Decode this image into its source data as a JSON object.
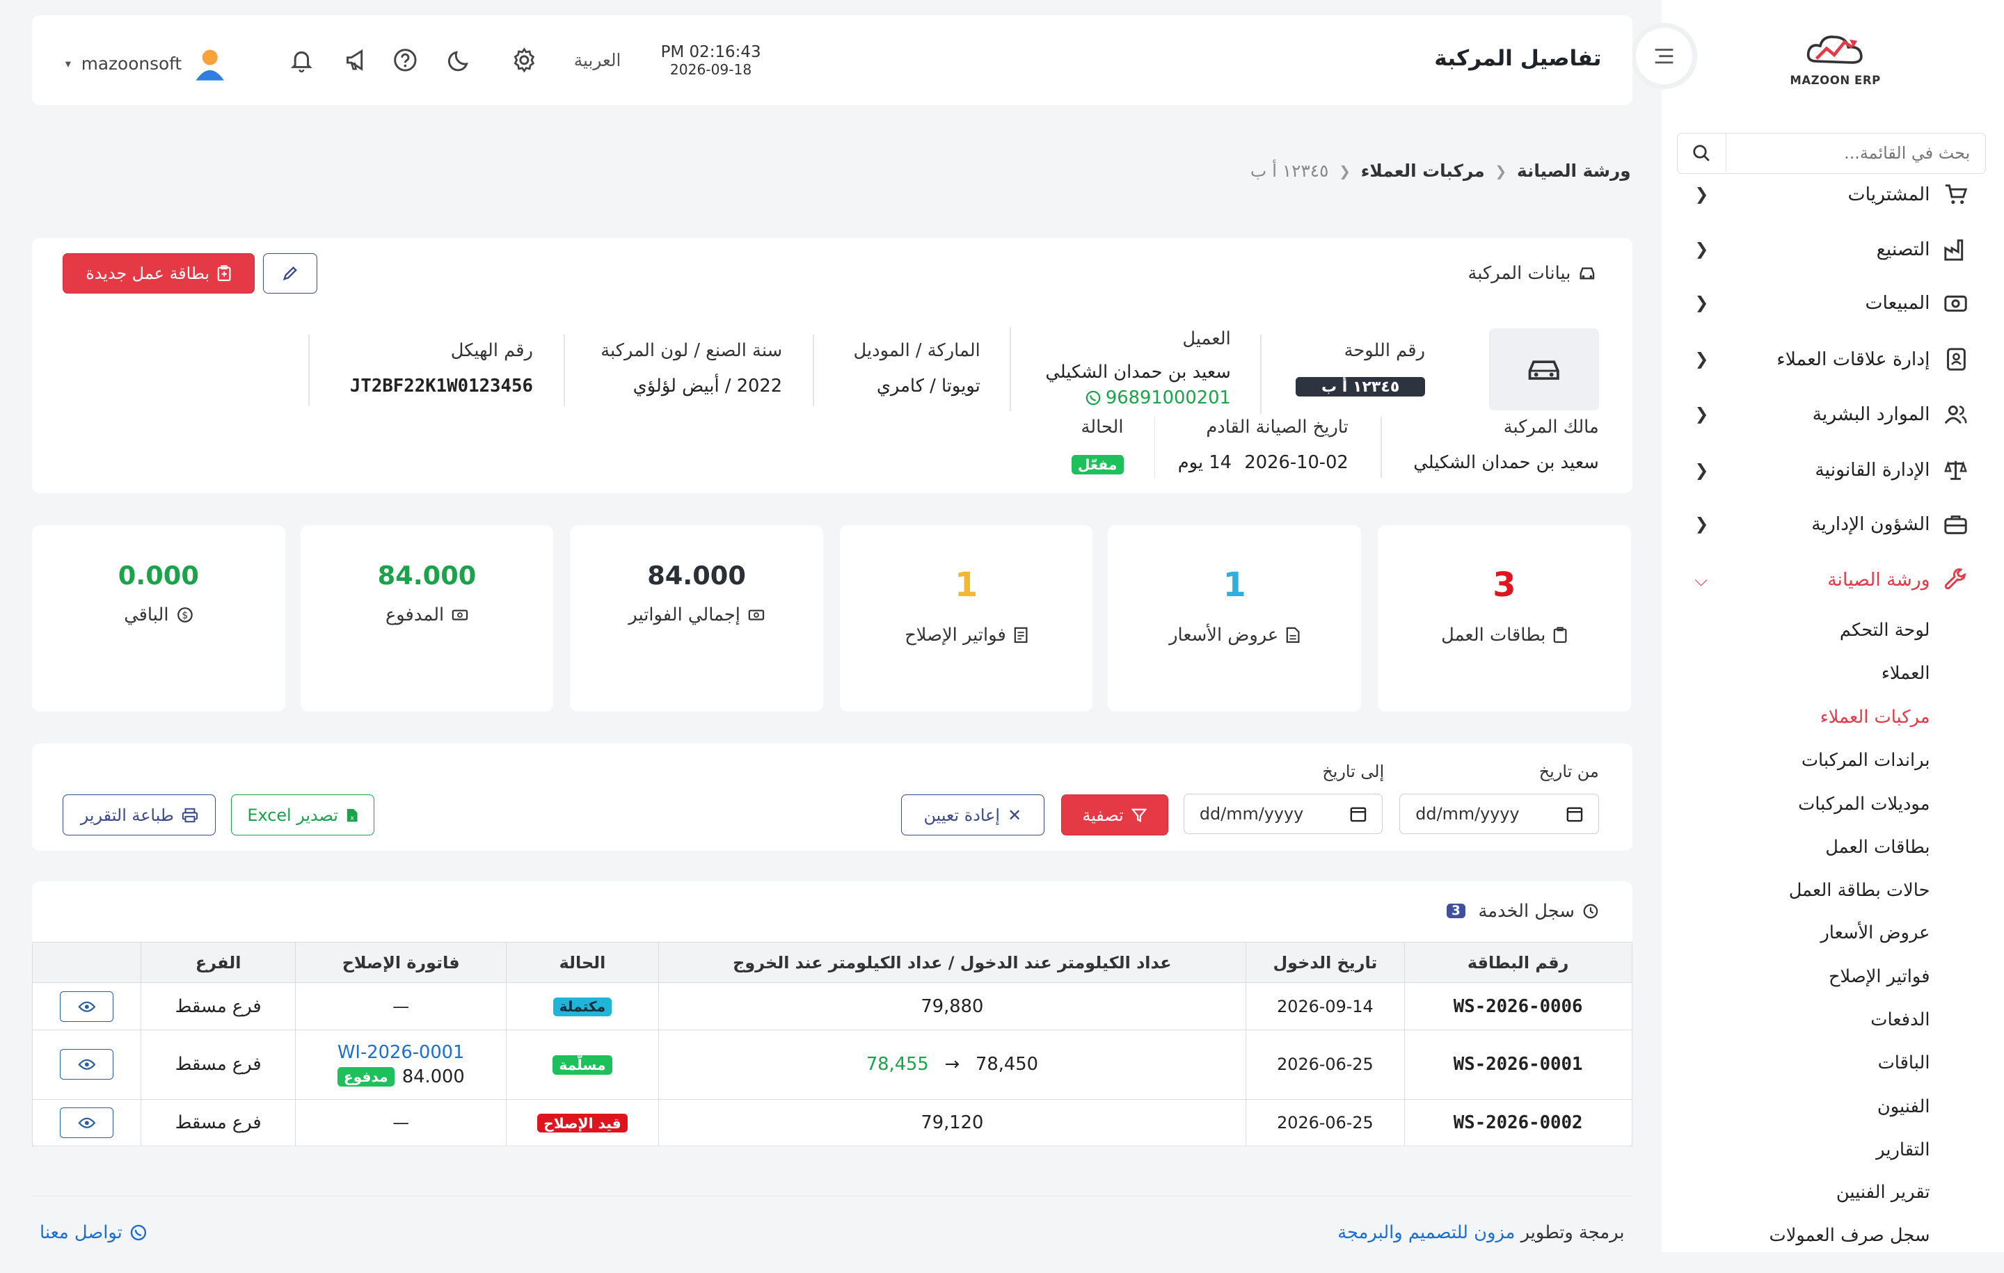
{
  "app": {
    "brand": "MAZOON ERP"
  },
  "sidebar": {
    "search_placeholder": "بحث في القائمة...",
    "items": [
      {
        "label": "المشتريات",
        "icon": "cart-icon"
      },
      {
        "label": "التصنيع",
        "icon": "factory-icon"
      },
      {
        "label": "المبيعات",
        "icon": "cash-icon"
      },
      {
        "label": "إدارة علاقات العملاء",
        "icon": "contacts-icon"
      },
      {
        "label": "الموارد البشرية",
        "icon": "users-icon"
      },
      {
        "label": "الإدارة القانونية",
        "icon": "scale-icon"
      },
      {
        "label": "الشؤون الإدارية",
        "icon": "briefcase-icon"
      },
      {
        "label": "ورشة الصيانة",
        "icon": "wrench-icon"
      }
    ],
    "sub_items": [
      "لوحة التحكم",
      "العملاء",
      "مركبات العملاء",
      "براندات المركبات",
      "موديلات المركبات",
      "بطاقات العمل",
      "حالات بطاقة العمل",
      "عروض الأسعار",
      "فواتير الإصلاح",
      "الدفعات",
      "الباقات",
      "الفنيون",
      "التقارير",
      "تقرير الفنيين",
      "سجل صرف العمولات"
    ]
  },
  "header": {
    "title": "تفاصيل المركبة",
    "time": "PM 02:16:43",
    "date": "2026-09-18",
    "language": "العربية",
    "username": "mazoonsoft"
  },
  "breadcrumb": {
    "items": [
      "ورشة الصيانة",
      "مركبات العملاء",
      "١٢٣٤٥ أ ب"
    ]
  },
  "vehicle": {
    "section_title": "بيانات المركبة",
    "new_job_card_label": "بطاقة عمل جديدة",
    "plate_label": "رقم اللوحة",
    "plate_value": "١٢٣٤٥ أ ب",
    "customer_label": "العميل",
    "customer_name": "سعيد بن حمدان الشكيلي",
    "customer_phone": "96891000201",
    "brand_model_label": "الماركة / الموديل",
    "brand_model_value": "تويوتا / كامري",
    "year_color_label": "سنة الصنع / لون المركبة",
    "year_color_value": "2022 / أبيض لؤلؤي",
    "vin_label": "رقم الهيكل",
    "vin_value": "JT2BF22K1W0123456",
    "owner_label": "مالك المركبة",
    "owner_value": "سعيد بن حمدان الشكيلي",
    "next_service_label": "تاريخ الصيانة القادم",
    "next_service_date": "2026-10-02",
    "next_service_days": "14 يوم",
    "status_label": "الحالة",
    "status_value": "مفعّل"
  },
  "stats": [
    {
      "label": "بطاقات العمل",
      "value": "3",
      "color": "#e0141e"
    },
    {
      "label": "عروض الأسعار",
      "value": "1",
      "color": "#2bb0e0"
    },
    {
      "label": "فواتير الإصلاح",
      "value": "1",
      "color": "#f5b731"
    },
    {
      "label": "إجمالي الفواتير",
      "value": "84.000",
      "color": "#2b2f36"
    },
    {
      "label": "المدفوع",
      "value": "84.000",
      "color": "#1aa34a"
    },
    {
      "label": "الباقي",
      "value": "0.000",
      "color": "#1aa34a"
    }
  ],
  "filter": {
    "from_label": "من تاريخ",
    "to_label": "إلى تاريخ",
    "date_placeholder": "dd/mm/yyyy",
    "filter_label": "تصفية",
    "reset_label": "إعادة تعيين",
    "export_label": "تصدير Excel",
    "print_label": "طباعة التقرير"
  },
  "service_log": {
    "title": "سجل الخدمة",
    "count": "3",
    "columns": [
      "رقم البطاقة",
      "تاريخ الدخول",
      "عداد الكيلومتر عند الدخول / عداد الكيلومتر عند الخروج",
      "الحالة",
      "فاتورة الإصلاح",
      "الفرع",
      ""
    ],
    "rows": [
      {
        "card_no": "WS-2026-0006",
        "date": "2026-09-14",
        "km_in": "79,880",
        "km_out": "",
        "status": "مكتملة",
        "status_type": "teal",
        "invoice_no": "—",
        "invoice_amount": "",
        "invoice_status": "",
        "branch": "فرع مسقط"
      },
      {
        "card_no": "WS-2026-0001",
        "date": "2026-06-25",
        "km_in": "78,450",
        "km_out": "78,455",
        "status": "مسلّمة",
        "status_type": "green",
        "invoice_no": "WI-2026-0001",
        "invoice_amount": "84.000",
        "invoice_status": "مدفوع",
        "branch": "فرع مسقط"
      },
      {
        "card_no": "WS-2026-0002",
        "date": "2026-06-25",
        "km_in": "79,120",
        "km_out": "",
        "status": "قيد الإصلاح",
        "status_type": "red",
        "invoice_no": "—",
        "invoice_amount": "",
        "invoice_status": "",
        "branch": "فرع مسقط"
      }
    ]
  },
  "footer": {
    "credit_prefix": "برمجة وتطوير",
    "credit_link": "مزون للتصميم والبرمجة",
    "contact": "تواصل معنا"
  }
}
